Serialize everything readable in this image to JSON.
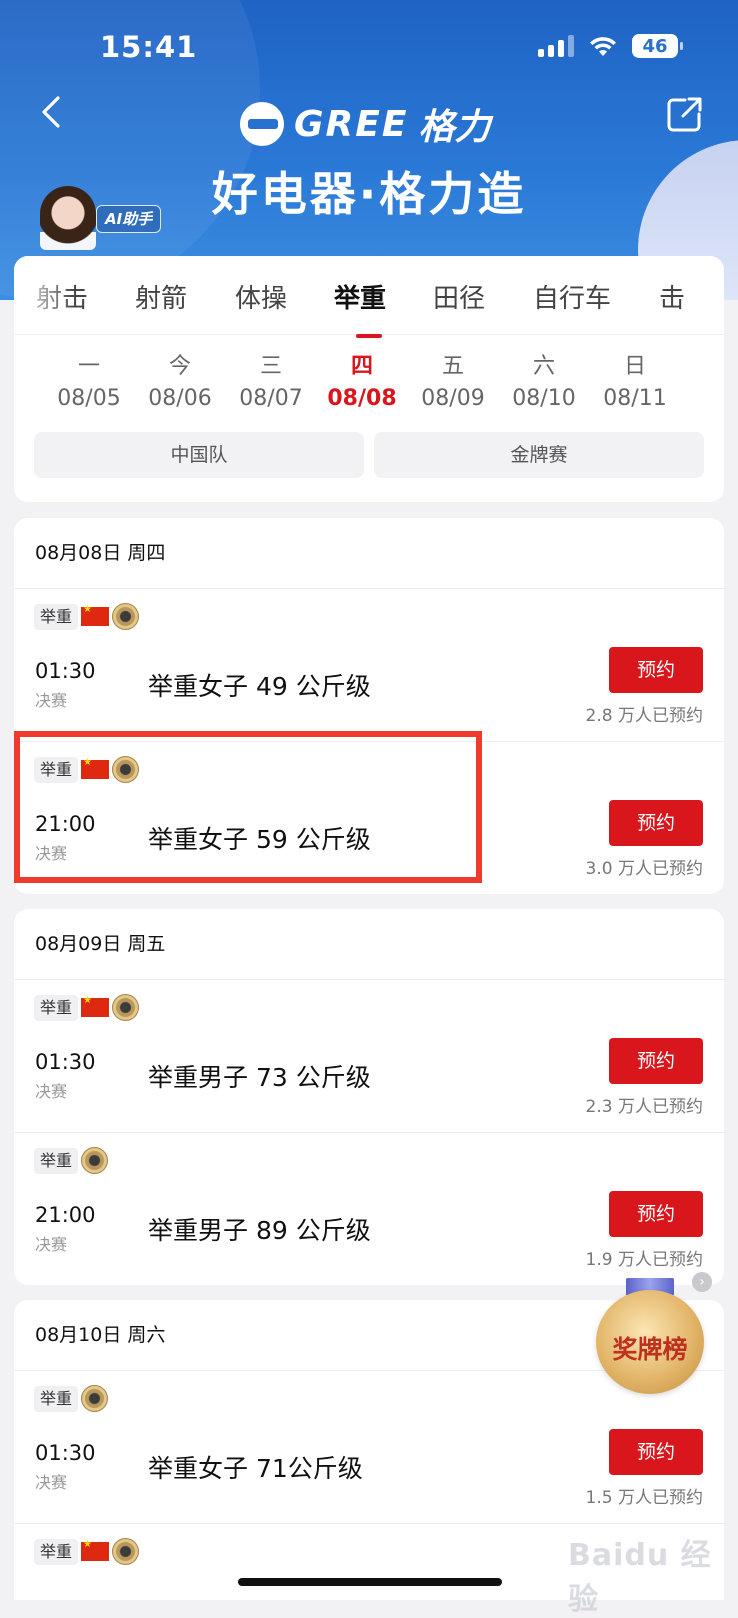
{
  "status": {
    "time": "15:41",
    "battery": "46"
  },
  "header": {
    "brand_en": "GREE",
    "brand_cn": "格力",
    "slogan": "好电器·格力造",
    "ai_tag": "AI助手"
  },
  "categories": [
    {
      "label": "射击",
      "active": false
    },
    {
      "label": "射箭",
      "active": false
    },
    {
      "label": "体操",
      "active": false
    },
    {
      "label": "举重",
      "active": true
    },
    {
      "label": "田径",
      "active": false
    },
    {
      "label": "自行车",
      "active": false
    },
    {
      "label": "击",
      "active": false
    }
  ],
  "dates": [
    {
      "dow": "一",
      "date": "08/05"
    },
    {
      "dow": "今",
      "date": "08/06"
    },
    {
      "dow": "三",
      "date": "08/07"
    },
    {
      "dow": "四",
      "date": "08/08",
      "active": true
    },
    {
      "dow": "五",
      "date": "08/09"
    },
    {
      "dow": "六",
      "date": "08/10"
    },
    {
      "dow": "日",
      "date": "08/11"
    }
  ],
  "filters": {
    "china_team": "中国队",
    "gold_medal": "金牌赛"
  },
  "days": [
    {
      "header": "08月08日 周四",
      "events": [
        {
          "sport": "举重",
          "china": true,
          "time": "01:30",
          "stage": "决赛",
          "name": "举重女子 49 公斤级",
          "button": "预约",
          "count": "2.8 万人已预约"
        },
        {
          "sport": "举重",
          "china": true,
          "time": "21:00",
          "stage": "决赛",
          "name": "举重女子 59 公斤级",
          "button": "预约",
          "count": "3.0 万人已预约"
        }
      ]
    },
    {
      "header": "08月09日 周五",
      "events": [
        {
          "sport": "举重",
          "china": true,
          "time": "01:30",
          "stage": "决赛",
          "name": "举重男子 73 公斤级",
          "button": "预约",
          "count": "2.3 万人已预约"
        },
        {
          "sport": "举重",
          "china": false,
          "time": "21:00",
          "stage": "决赛",
          "name": "举重男子 89 公斤级",
          "button": "预约",
          "count": "1.9 万人已预约"
        }
      ]
    },
    {
      "header": "08月10日 周六",
      "events": [
        {
          "sport": "举重",
          "china": false,
          "time": "01:30",
          "stage": "决赛",
          "name": "举重女子 71公斤级",
          "button": "预约",
          "count": "1.5 万人已预约"
        },
        {
          "sport": "举重",
          "china": true,
          "time": "",
          "stage": "",
          "name": "",
          "button": "",
          "count": ""
        }
      ]
    }
  ],
  "medal_board": {
    "label": "奖牌榜"
  },
  "watermark": "Baidu 经验",
  "colors": {
    "accent": "#d8161b",
    "banner": "#2a78d6",
    "highlight": "#f03a2b"
  }
}
